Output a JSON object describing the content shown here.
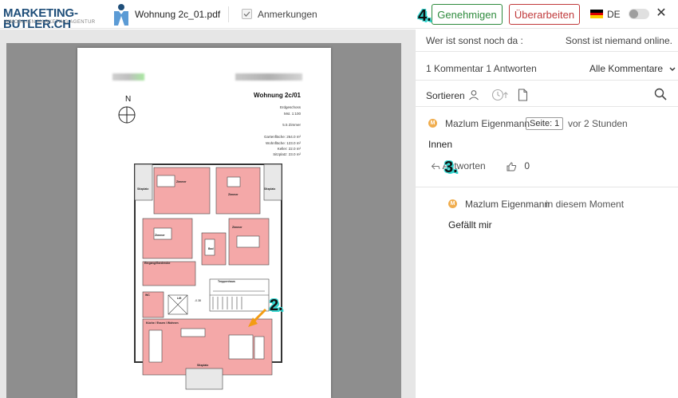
{
  "header": {
    "logo_text": "MARKETING-BUTLER.CH",
    "logo_tagline": "IMMOBILIEN MARKETING AGENTUR",
    "filename": "Wohnung 2c_01.pdf",
    "annotations_label": "Anmerkungen",
    "approve_label": "Genehmigen",
    "revise_label": "Überarbeiten",
    "language": "DE",
    "close_symbol": "✕"
  },
  "plan": {
    "title": "Wohnung 2c/01",
    "floor": "Erdgeschoss",
    "scale": "Mst. 1:100",
    "rooms": "5.5 Zimmer",
    "garden_area": "Gartenfläche: 264.0 m²",
    "living_area": "Wohnfläche: 123.0 m²",
    "cellar": "Keller: 22.0 m²",
    "seating_area": "Sitzplatz: 23.0 m²",
    "north": "N",
    "labels": {
      "zimmer": "Zimmer",
      "sitzplatz": "Sitzplatz",
      "bad": "Bad",
      "eingang": "Eingang/Garderobe",
      "treppenhaus": "Treppenhaus",
      "lift": "Lift",
      "wc": "WC",
      "kueche": "Küche / Essen / Wohnen",
      "level": "-0.38"
    }
  },
  "panel": {
    "online_label": "Wer ist sonst noch da :",
    "online_status": "Sonst ist niemand online.",
    "count": "1 Kommentar 1 Antworten",
    "filter": "Alle Kommentare",
    "sort_label": "Sortieren",
    "comment": {
      "avatar": "M",
      "author": "Mazlum Eigenmann",
      "page": "Seite: 1",
      "time": "vor 2 Stunden",
      "text": "Innen",
      "reply_label": "Antworten",
      "likes": "0"
    },
    "reply": {
      "avatar": "M",
      "author": "Mazlum Eigenmann",
      "time": "in diesem Moment",
      "text": "Gefällt mir"
    }
  },
  "callouts": {
    "step2": "2.",
    "step3": "3.",
    "step4": "4."
  },
  "colors": {
    "approve": "#2e8b3d",
    "revise": "#c0393b",
    "avatar": "#f0ad4e",
    "plan_room": "#f4a8a8",
    "callout_outline": "#35d6d0"
  }
}
